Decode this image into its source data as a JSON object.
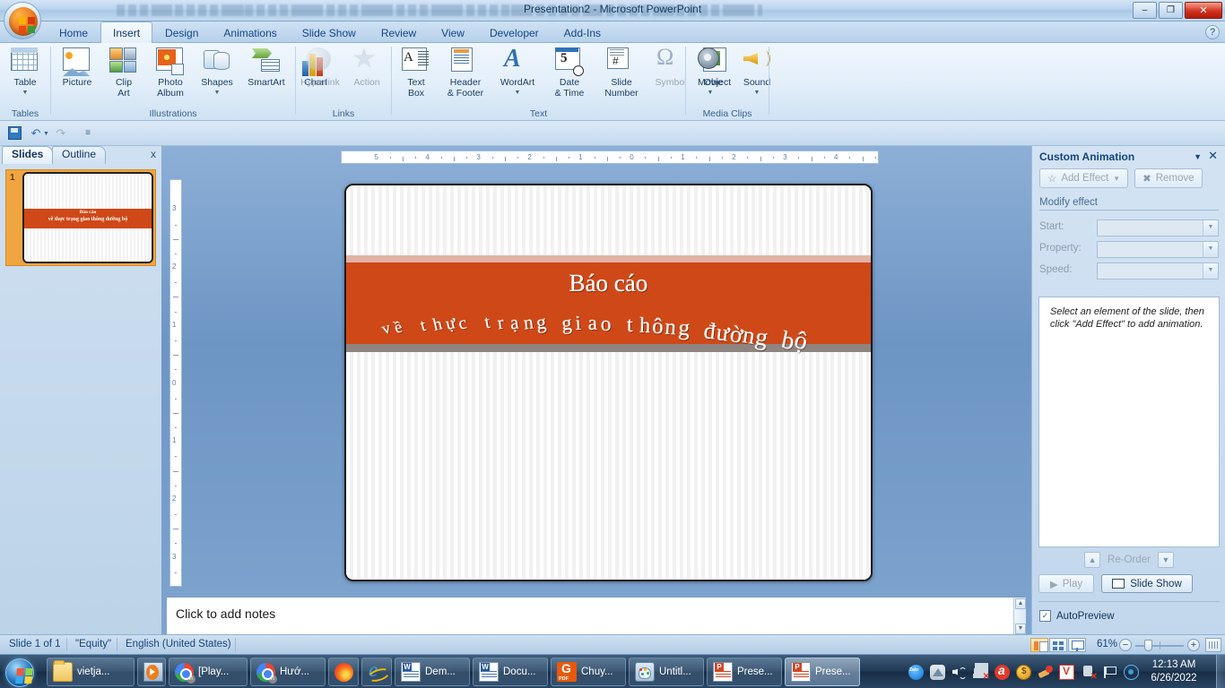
{
  "window": {
    "title": "Presentation2 - Microsoft PowerPoint",
    "minimize": "–",
    "maximize": "❐",
    "close": "✕",
    "help": "?"
  },
  "ribbon": {
    "tabs": [
      {
        "label": "Home",
        "active": false
      },
      {
        "label": "Insert",
        "active": true
      },
      {
        "label": "Design",
        "active": false
      },
      {
        "label": "Animations",
        "active": false
      },
      {
        "label": "Slide Show",
        "active": false
      },
      {
        "label": "Review",
        "active": false
      },
      {
        "label": "View",
        "active": false
      },
      {
        "label": "Developer",
        "active": false
      },
      {
        "label": "Add-Ins",
        "active": false
      }
    ],
    "groups": [
      {
        "name": "Tables",
        "label": "Tables",
        "items": [
          {
            "label": "Table",
            "icon": "table-icon",
            "caret": true,
            "disabled": false
          }
        ]
      },
      {
        "name": "Illustrations",
        "label": "Illustrations",
        "items": [
          {
            "label": "Picture",
            "icon": "picture-icon",
            "caret": false,
            "disabled": false
          },
          {
            "label": "Clip\nArt",
            "icon": "clip-art-icon",
            "caret": false,
            "disabled": false
          },
          {
            "label": "Photo\nAlbum",
            "icon": "photo-album-icon",
            "caret": true,
            "disabled": false
          },
          {
            "label": "Shapes",
            "icon": "shapes-icon",
            "caret": true,
            "disabled": false
          },
          {
            "label": "SmartArt",
            "icon": "smartart-icon",
            "caret": false,
            "disabled": false
          },
          {
            "label": "Chart",
            "icon": "chart-icon",
            "caret": false,
            "disabled": false
          }
        ]
      },
      {
        "name": "Links",
        "label": "Links",
        "items": [
          {
            "label": "Hyperlink",
            "icon": "hyperlink-icon",
            "caret": false,
            "disabled": true
          },
          {
            "label": "Action",
            "icon": "action-icon",
            "caret": false,
            "disabled": true
          }
        ]
      },
      {
        "name": "Text",
        "label": "Text",
        "items": [
          {
            "label": "Text\nBox",
            "icon": "text-box-icon",
            "caret": false,
            "disabled": false
          },
          {
            "label": "Header\n& Footer",
            "icon": "header-footer-icon",
            "caret": false,
            "disabled": false
          },
          {
            "label": "WordArt",
            "icon": "wordart-icon",
            "caret": true,
            "disabled": false
          },
          {
            "label": "Date\n& Time",
            "icon": "date-time-icon",
            "caret": false,
            "disabled": false
          },
          {
            "label": "Slide\nNumber",
            "icon": "slide-number-icon",
            "caret": false,
            "disabled": false
          },
          {
            "label": "Symbol",
            "icon": "symbol-icon",
            "caret": false,
            "disabled": true
          },
          {
            "label": "Object",
            "icon": "object-icon",
            "caret": false,
            "disabled": false
          }
        ]
      },
      {
        "name": "Media Clips",
        "label": "Media Clips",
        "items": [
          {
            "label": "Movie",
            "icon": "movie-icon",
            "caret": true,
            "disabled": false
          },
          {
            "label": "Sound",
            "icon": "sound-icon",
            "caret": true,
            "disabled": false
          }
        ]
      }
    ]
  },
  "quick_access": {
    "save": "save-icon",
    "undo": "↶",
    "redo": "↷",
    "customize": "≡"
  },
  "left_pane": {
    "tabs": [
      {
        "label": "Slides",
        "selected": true
      },
      {
        "label": "Outline",
        "selected": false
      }
    ],
    "close": "x",
    "slide_number": "1",
    "thumb_line1": "Báo cáo",
    "thumb_line2": "về thực trạng giao thông đường bộ"
  },
  "rulers": {
    "horizontal": [
      "5",
      "4",
      "3",
      "2",
      "1",
      "0",
      "1",
      "2",
      "3",
      "4"
    ],
    "vertical": [
      "3",
      "2",
      "1",
      "0",
      "1",
      "2",
      "3"
    ]
  },
  "slide": {
    "title_line1": "Báo cáo",
    "title_line2": "về thực trạng giao thông đường bộ",
    "band_color": "#cf4817",
    "band_shadow_color": "#8f8480",
    "band_highlight_color": "#e2b3a4"
  },
  "notes": {
    "placeholder": "Click to add notes",
    "scroll_up": "▲",
    "scroll_down": "▼"
  },
  "task_pane": {
    "title": "Custom Animation",
    "dropdown": "▼",
    "close": "✕",
    "add_effect": "Add Effect",
    "add_effect_caret": "▼",
    "remove": "Remove",
    "modify_effect": "Modify effect",
    "fields": [
      {
        "label": "Start:",
        "value": ""
      },
      {
        "label": "Property:",
        "value": ""
      },
      {
        "label": "Speed:",
        "value": ""
      }
    ],
    "hint": "Select an element of the slide, then click \"Add Effect\" to add animation.",
    "reorder": "Re-Order",
    "reorder_up": "▲",
    "reorder_down": "▼",
    "play": "Play",
    "play_icon": "▶",
    "slide_show": "Slide Show",
    "autopreview": "AutoPreview",
    "autopreview_checked": "✓"
  },
  "status_bar": {
    "slide_count": "Slide 1 of 1",
    "theme": "\"Equity\"",
    "language": "English (United States)",
    "zoom": "61%",
    "zoom_out": "−",
    "zoom_in": "+",
    "views": [
      "normal-view",
      "slide-sorter-view",
      "slide-show-view"
    ]
  },
  "taskbar": {
    "start": "start-orb",
    "items": [
      {
        "label": "vietja...",
        "icon": "folder-icon",
        "active": false,
        "width": 98
      },
      {
        "label": "",
        "icon": "media-player-icon",
        "active": false,
        "width": 32
      },
      {
        "label": "[Play...",
        "icon": "chrome-icon",
        "active": false,
        "width": 88
      },
      {
        "label": "Hướ...",
        "icon": "chrome-icon",
        "active": false,
        "width": 84
      },
      {
        "label": "",
        "icon": "firefox-icon",
        "active": false,
        "width": 34
      },
      {
        "label": "",
        "icon": "internet-explorer-icon",
        "active": false,
        "width": 34
      },
      {
        "label": "Dem...",
        "icon": "word-icon",
        "active": false,
        "width": 84
      },
      {
        "label": "Docu...",
        "icon": "word-icon",
        "active": false,
        "width": 84
      },
      {
        "label": "Chuy...",
        "icon": "pdf-icon",
        "active": false,
        "width": 84
      },
      {
        "label": "Untitl...",
        "icon": "paint-icon",
        "active": false,
        "width": 84
      },
      {
        "label": "Prese...",
        "icon": "powerpoint-icon",
        "active": false,
        "width": 84
      },
      {
        "label": "Prese...",
        "icon": "powerpoint-icon",
        "active": true,
        "width": 84
      }
    ],
    "tray": [
      "zalo-icon",
      "drive-icon",
      "volume-icon",
      "network-disconnected-icon",
      "avira-icon",
      "coin-icon",
      "cleaner-icon",
      "v-icon",
      "usb-disconnected-icon",
      "flag-icon",
      "eye-icon"
    ],
    "time": "12:13 AM",
    "date": "6/26/2022"
  }
}
